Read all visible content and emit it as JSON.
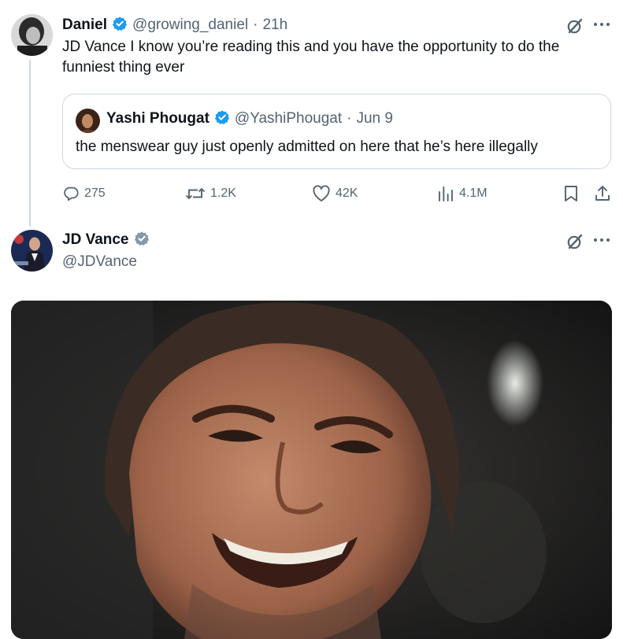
{
  "parent_tweet": {
    "author_name": "Daniel",
    "handle": "@growing_daniel",
    "separator": "·",
    "time": "21h",
    "text": "JD Vance I know you’re reading this and you have the opportunity to do the funniest thing ever",
    "quote": {
      "author_name": "Yashi Phougat",
      "handle": "@YashiPhougat",
      "separator": "·",
      "date": "Jun 9",
      "text": "the menswear guy just openly admitted on here that he’s here illegally"
    },
    "actions": {
      "replies": "275",
      "reposts": "1.2K",
      "likes": "42K",
      "views": "4.1M"
    }
  },
  "reply_tweet": {
    "author_name": "JD Vance",
    "handle": "@JDVance",
    "verified_badge_color": "#829aab"
  },
  "colors": {
    "verified_blue": "#1d9bf0",
    "text": "#0f1419",
    "muted": "#536471",
    "border": "#cfd9de"
  },
  "icons": [
    "verified-badge-icon",
    "grok-icon",
    "more-icon",
    "reply-icon",
    "repost-icon",
    "like-icon",
    "views-icon",
    "bookmark-icon",
    "share-icon"
  ]
}
